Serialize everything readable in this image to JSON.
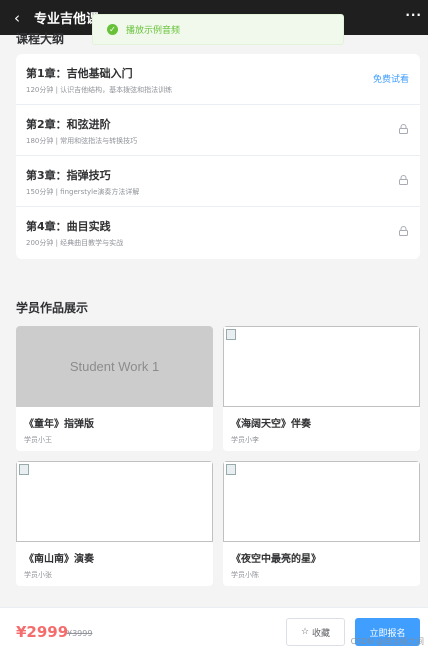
{
  "topbar": {
    "title": "专业吉他课",
    "more": "···"
  },
  "toast": {
    "message": "播放示例音频",
    "icon": "check-circle-icon"
  },
  "outline": {
    "heading": "课程大纲",
    "chapters": [
      {
        "title": "第1章：吉他基础入门",
        "desc": "120分钟 | 认识吉他结构，基本拨弦和指法训练",
        "action": "免费试看",
        "locked": false
      },
      {
        "title": "第2章：和弦进阶",
        "desc": "180分钟 | 常用和弦指法与转换技巧",
        "locked": true
      },
      {
        "title": "第3章：指弹技巧",
        "desc": "150分钟 | fingerstyle演奏方法详解",
        "locked": true
      },
      {
        "title": "第4章：曲目实践",
        "desc": "200分钟 | 经典曲目教学与实战",
        "locked": true
      }
    ]
  },
  "works": {
    "heading": "学员作品展示",
    "items": [
      {
        "title": "《童年》指弹版",
        "author": "学员小王",
        "placeholder": "Student Work 1"
      },
      {
        "title": "《海阔天空》伴奏",
        "author": "学员小李"
      },
      {
        "title": "《南山南》演奏",
        "author": "学员小张"
      },
      {
        "title": "《夜空中最亮的星》",
        "author": "学员小陈"
      }
    ]
  },
  "bottom": {
    "price": "¥2999",
    "old_price": "¥3999",
    "favorite": "收藏",
    "enroll": "立即报名",
    "watermark": "CSDN @南北极之间"
  },
  "colors": {
    "accent": "#409eff",
    "price": "#f56c6c",
    "success": "#67c23a"
  }
}
